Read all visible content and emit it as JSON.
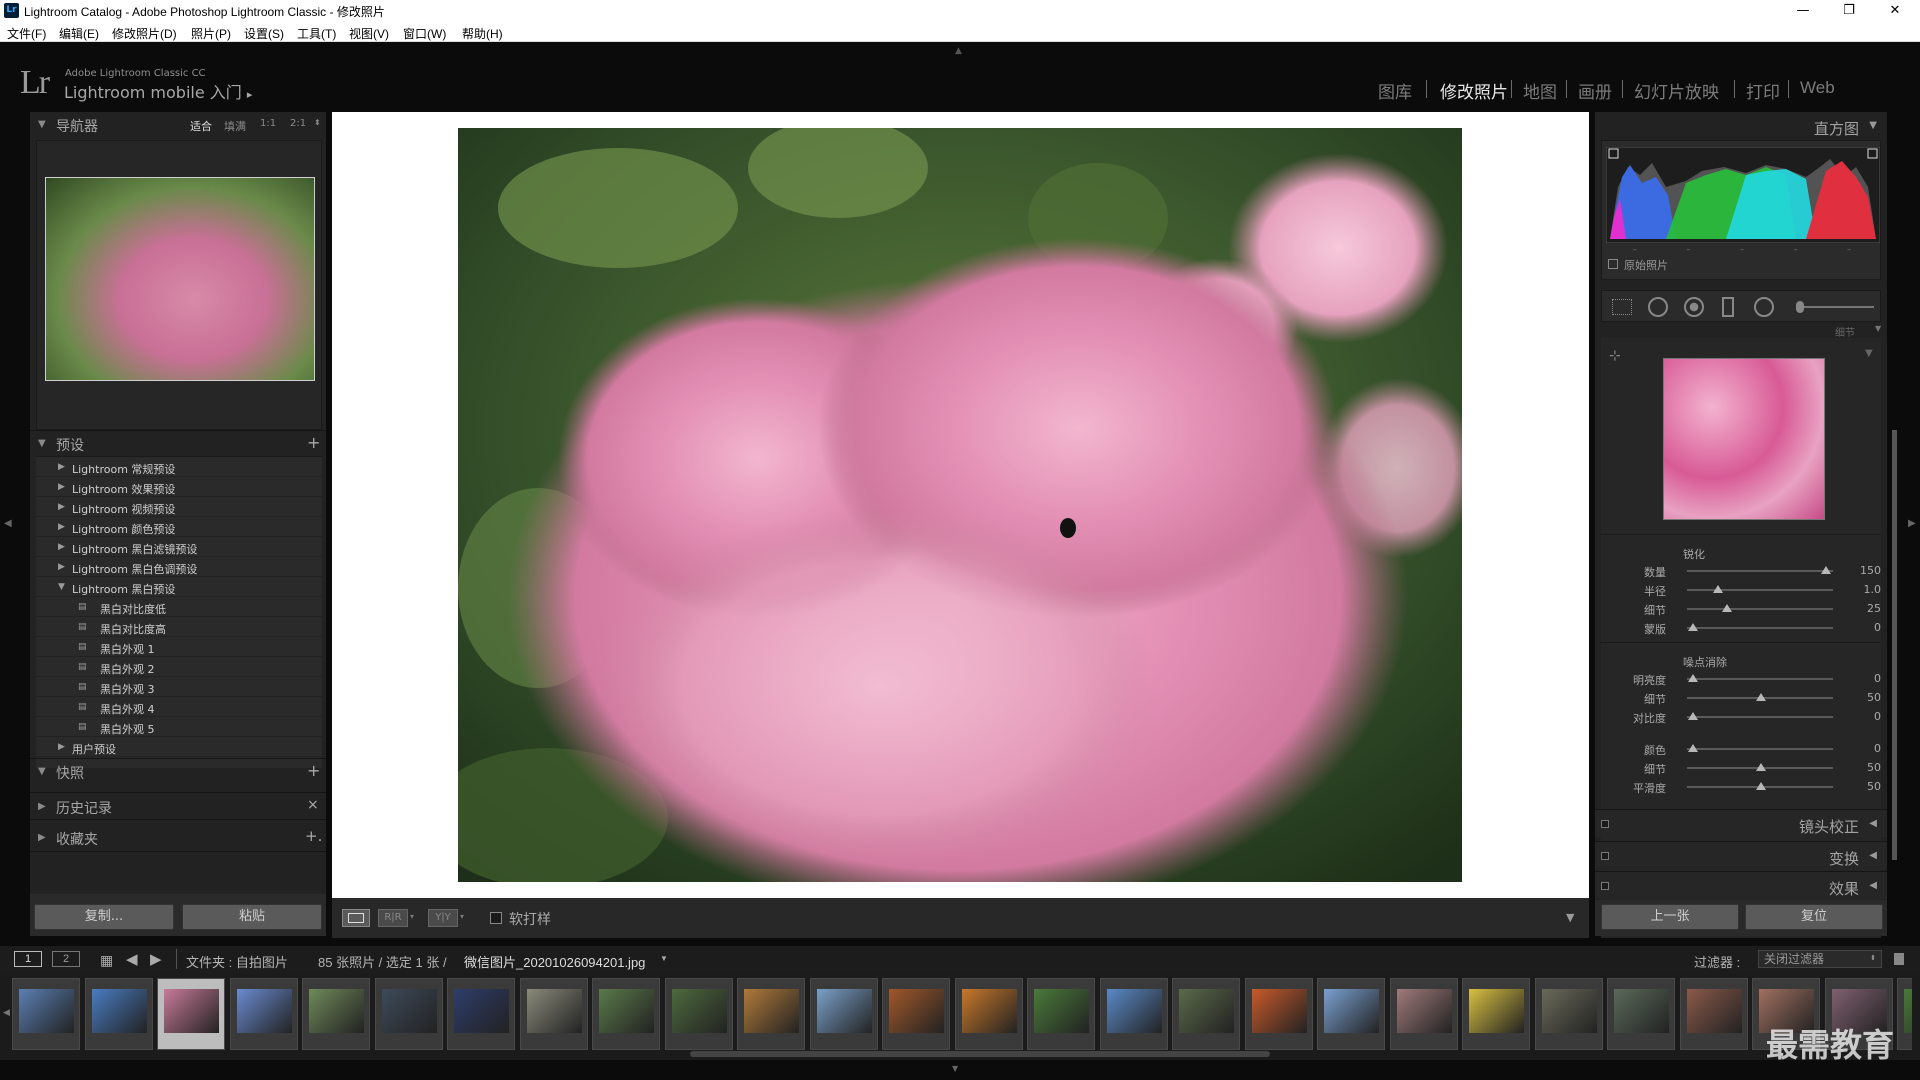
{
  "titlebar": {
    "title": "Lightroom Catalog - Adobe Photoshop Lightroom Classic - 修改照片",
    "icon": "Lr",
    "min": "—",
    "max": "❐",
    "close": "✕"
  },
  "menu": [
    "文件(F)",
    "编辑(E)",
    "修改照片(D)",
    "照片(P)",
    "设置(S)",
    "工具(T)",
    "视图(V)",
    "窗口(W)",
    "帮助(H)"
  ],
  "identity": {
    "logo": "Lr",
    "line1": "Adobe Lightroom Classic CC",
    "line2": "Lightroom mobile 入门",
    "arrow": "▸"
  },
  "modules": {
    "items": [
      "图库",
      "修改照片",
      "地图",
      "画册",
      "幻灯片放映",
      "打印",
      "Web"
    ],
    "active": "修改照片"
  },
  "navigator": {
    "title": "导航器",
    "zoom": [
      "适合",
      "填满",
      "1:1",
      "2:1"
    ]
  },
  "presets": {
    "title": "预设",
    "add": "+",
    "items": [
      {
        "label": "Lightroom 常规预设",
        "type": "folder",
        "expanded": false
      },
      {
        "label": "Lightroom 效果预设",
        "type": "folder",
        "expanded": false
      },
      {
        "label": "Lightroom 视频预设",
        "type": "folder",
        "expanded": false
      },
      {
        "label": "Lightroom 颜色预设",
        "type": "folder",
        "expanded": false
      },
      {
        "label": "Lightroom 黑白滤镜预设",
        "type": "folder",
        "expanded": false
      },
      {
        "label": "Lightroom 黑白色调预设",
        "type": "folder",
        "expanded": false
      },
      {
        "label": "Lightroom 黑白预设",
        "type": "folder",
        "expanded": true
      },
      {
        "label": "黑白对比度低",
        "type": "preset"
      },
      {
        "label": "黑白对比度高",
        "type": "preset"
      },
      {
        "label": "黑白外观 1",
        "type": "preset"
      },
      {
        "label": "黑白外观 2",
        "type": "preset"
      },
      {
        "label": "黑白外观 3",
        "type": "preset"
      },
      {
        "label": "黑白外观 4",
        "type": "preset"
      },
      {
        "label": "黑白外观 5",
        "type": "preset"
      },
      {
        "label": "用户预设",
        "type": "folder",
        "expanded": false
      }
    ]
  },
  "snapshots": {
    "title": "快照",
    "add": "+"
  },
  "history": {
    "title": "历史记录",
    "clear": "×"
  },
  "collections": {
    "title": "收藏夹",
    "add": "+."
  },
  "left_buttons": {
    "copy": "复制...",
    "paste": "粘贴"
  },
  "toolbar": {
    "softproof": "软打样"
  },
  "histogram": {
    "title": "直方图",
    "original": "原始照片",
    "dashes": [
      "–",
      "–",
      "–",
      "–",
      "–"
    ]
  },
  "detail": {
    "collapsed_label": "细节",
    "sharpening": {
      "title": "锐化",
      "rows": [
        {
          "label": "数量",
          "value": "150",
          "pct": 0.98
        },
        {
          "label": "半径",
          "value": "1.0",
          "pct": 0.22
        },
        {
          "label": "细节",
          "value": "25",
          "pct": 0.28
        },
        {
          "label": "蒙版",
          "value": "0",
          "pct": 0.04
        }
      ]
    },
    "noise": {
      "title": "噪点消除",
      "luminance": [
        {
          "label": "明亮度",
          "value": "0",
          "pct": 0.04
        },
        {
          "label": "细节",
          "value": "50",
          "pct": 0.52
        },
        {
          "label": "对比度",
          "value": "0",
          "pct": 0.04
        }
      ],
      "color": [
        {
          "label": "颜色",
          "value": "0",
          "pct": 0.04
        },
        {
          "label": "细节",
          "value": "50",
          "pct": 0.52
        },
        {
          "label": "平滑度",
          "value": "50",
          "pct": 0.52
        }
      ]
    }
  },
  "right_sections": [
    "镜头校正",
    "变换",
    "效果"
  ],
  "right_buttons": {
    "prev": "上一张",
    "reset": "复位"
  },
  "filmstrip": {
    "view1": "1",
    "view2": "2",
    "path": "文件夹 : 自拍图片",
    "count": "85 张照片 / 选定 1 张 /",
    "filename": "微信图片_20201026094201.jpg",
    "filter_label": "过滤器 :",
    "filter_value": "关闭过滤器"
  },
  "thumbs_colors": [
    "#5a7fb3",
    "#4a7cc2",
    "#c87a98",
    "#6a8bd1",
    "#6f8a5a",
    "#3d4a5a",
    "#2e3d6a",
    "#8a8a7a",
    "#5a7a4a",
    "#4d6a3d",
    "#b07a3a",
    "#7aa0c8",
    "#a0582a",
    "#c8782a",
    "#4a7a3a",
    "#5a8ac8",
    "#5a6a4a",
    "#c85a2a",
    "#7aa0d0",
    "#a07a7a",
    "#d8c040",
    "#6a6a5a",
    "#5a6a5a",
    "#8a5a4a",
    "#a07060",
    "#806070",
    "#4a7a3a"
  ],
  "watermark": "最需教育"
}
